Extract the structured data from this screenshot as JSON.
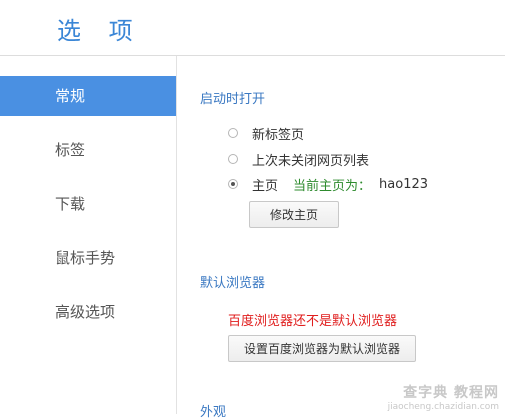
{
  "page": {
    "title": "选 项"
  },
  "sidebar": {
    "items": [
      {
        "label": "常规",
        "active": true
      },
      {
        "label": "标签",
        "active": false
      },
      {
        "label": "下载",
        "active": false
      },
      {
        "label": "鼠标手势",
        "active": false
      },
      {
        "label": "高级选项",
        "active": false
      }
    ]
  },
  "startup": {
    "title": "启动时打开",
    "options": [
      {
        "label": "新标签页",
        "checked": false
      },
      {
        "label": "上次未关闭网页列表",
        "checked": false
      },
      {
        "label": "主页",
        "checked": true
      }
    ],
    "homepage_info": "当前主页为：",
    "homepage_value": "hao123",
    "change_button": "修改主页"
  },
  "default_browser": {
    "title": "默认浏览器",
    "warning": "百度浏览器还不是默认浏览器",
    "set_button": "设置百度浏览器为默认浏览器"
  },
  "appearance": {
    "title": "外观"
  },
  "watermark": {
    "main": "查字典 教程网",
    "url": "jiaocheng.chazidian.com"
  },
  "colors": {
    "accent": "#4a90e2",
    "section_title": "#3a78c2",
    "warning": "#e01d1d",
    "info": "#2e8b2e"
  }
}
